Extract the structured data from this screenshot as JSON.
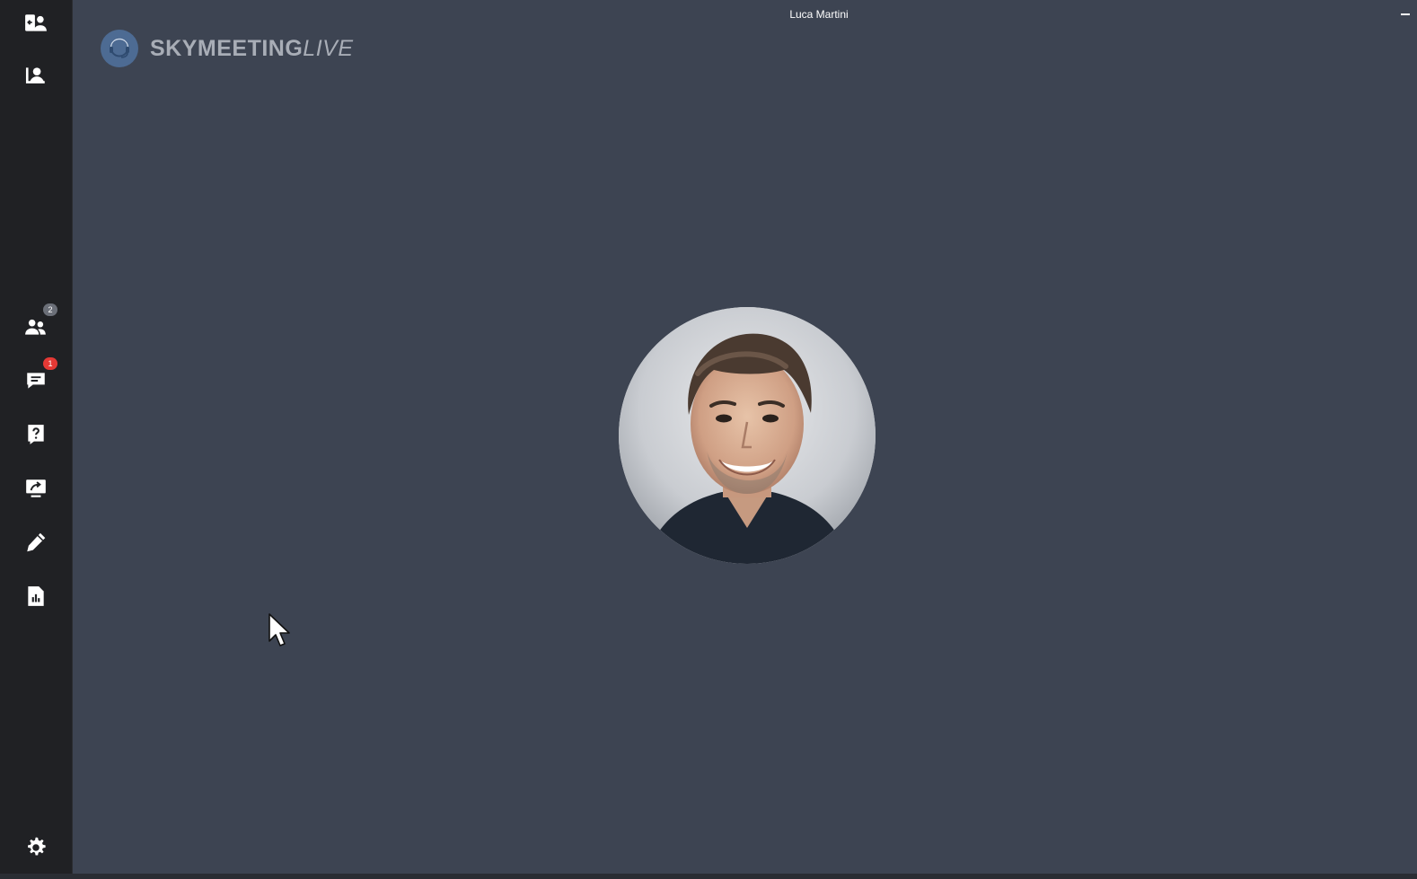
{
  "window": {
    "title": "Luca Martini"
  },
  "logo": {
    "brand_bold": "SKYMEETING",
    "brand_light": "LIVE",
    "icon": "headset-logo-icon"
  },
  "sidebar": {
    "items": [
      {
        "name": "user-switch-icon",
        "label": ""
      },
      {
        "name": "user-presenter-icon",
        "label": ""
      },
      {
        "name": "participants-icon",
        "badge": "2"
      },
      {
        "name": "chat-icon",
        "badge": "1"
      },
      {
        "name": "question-icon",
        "label": ""
      },
      {
        "name": "screen-share-icon",
        "label": ""
      },
      {
        "name": "pencil-icon",
        "label": ""
      },
      {
        "name": "report-icon",
        "label": ""
      }
    ],
    "settings": {
      "name": "gear-icon"
    }
  },
  "colors": {
    "background": "#3d4452",
    "sidebar": "#202124",
    "badge_alert": "#e53935",
    "badge_neutral": "#6b6f78",
    "logo_circle": "#4d6b93",
    "logo_text": "#a8adb6"
  },
  "avatar": {
    "alt": "Luca Martini"
  }
}
